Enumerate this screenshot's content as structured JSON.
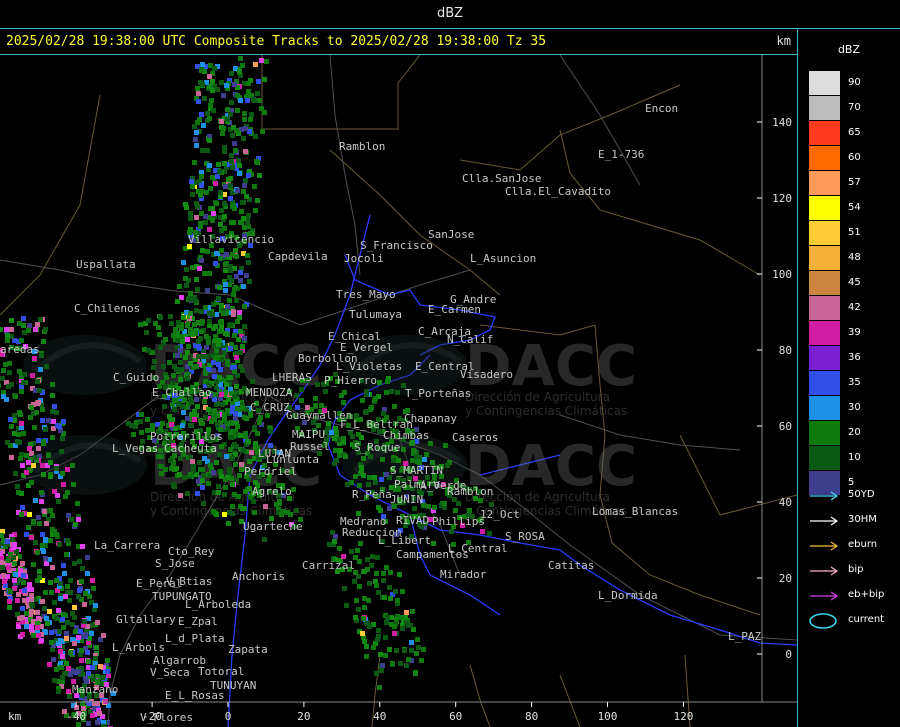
{
  "window": {
    "title": "dBZ"
  },
  "header": {
    "info": "2025/02/28 19:38:00 UTC Composite Tracks to 2025/02/28 19:38:00 Tz 35",
    "km_label": "km"
  },
  "axes": {
    "x_ticks": [
      "-40",
      "-20",
      "0",
      "20",
      "40",
      "60",
      "80",
      "100",
      "120"
    ],
    "y_ticks": [
      "140",
      "120",
      "100",
      "80",
      "60",
      "40",
      "20",
      "0"
    ],
    "x_unit": "km"
  },
  "watermark": {
    "brand": "DACC",
    "subtitle_1": "Dirección de Agricultura",
    "subtitle_2": "y Contingencias Climáticas"
  },
  "places": [
    "Uspallata",
    "C_Chilenos",
    "Villavicencio",
    "Capdevila",
    "Ramblon",
    "Encon",
    "E_1-736",
    "Clla.SanJose",
    "Clla.El_Cavadito",
    "SanJose",
    "S_Francisco",
    "Jocoli",
    "L_Asuncion",
    "Tres_Mayo",
    "Tulumaya",
    "G_Andre",
    "E_Carmen",
    "E_Chical",
    "E_Vergel",
    "C_Arcaja",
    "N_Calif",
    "Borbollon",
    "P_Hierro",
    "L_Violetas",
    "E_Central",
    "Visadero",
    "C_Guido",
    "E_Challao",
    "LHERAS",
    "MENDOZA",
    "C_CRUZ",
    "Guaymallen",
    "T_Porteñas",
    "Chapanay",
    "F_L_Beltran",
    "Potrerillos",
    "Cacheuta",
    "L_Vegas",
    "MAIPU",
    "Russel",
    "Chimbas",
    "Caseros",
    "S_Roque",
    "LUJAN",
    "Lunlunta",
    "Perdriel",
    "S_MARTIN",
    "Palmira",
    "Agrelo",
    "A_Verde",
    "Ramblon",
    "R_Peña",
    "JUNIN",
    "12_Oct",
    "Lomas_Blancas",
    "Phillips",
    "RIVAD",
    "Medrano",
    "Reduccion",
    "L_Libert",
    "S_ROSA",
    "Ugarteche",
    "La_Carrera",
    "Cto_Rey",
    "S_Jose",
    "Campamentos",
    "L_Central",
    "Catitas",
    "Carrizal",
    "Mirador",
    "E_Peral",
    "V_Btias",
    "Anchoris",
    "TUPUNGATO",
    "L_Arboleda",
    "L_Dormida",
    "Gltallary",
    "E_Zpal",
    "L_d_Plata",
    "L_Arbols",
    "Zapata",
    "L_PAZ",
    "Algarrob",
    "V_Seca",
    "Totoral",
    "Manzano",
    "E_L_Rosas",
    "TUNUYAN",
    "V_Flores",
    "aredas"
  ],
  "legend": {
    "title": "dBZ",
    "scale": [
      {
        "label": "90",
        "color": "#dcdcdc"
      },
      {
        "label": "70",
        "color": "#bdbdbd"
      },
      {
        "label": "65",
        "color": "#ff3a1e"
      },
      {
        "label": "60",
        "color": "#ff6a00"
      },
      {
        "label": "57",
        "color": "#ff9a5a"
      },
      {
        "label": "54",
        "color": "#ffff00"
      },
      {
        "label": "51",
        "color": "#ffcc33"
      },
      {
        "label": "48",
        "color": "#f7b13a"
      },
      {
        "label": "45",
        "color": "#cd853f"
      },
      {
        "label": "42",
        "color": "#c86496"
      },
      {
        "label": "39",
        "color": "#d21ea5"
      },
      {
        "label": "36",
        "color": "#7b1fd2"
      },
      {
        "label": "35",
        "color": "#2f4fe6"
      },
      {
        "label": "30",
        "color": "#1e90e6"
      },
      {
        "label": "20",
        "color": "#0e7a0e"
      },
      {
        "label": "10",
        "color": "#0a5a14"
      },
      {
        "label": "5",
        "color": "#3e3e8e"
      }
    ],
    "tracks": [
      {
        "label": "50YD",
        "color": "#40d8f0"
      },
      {
        "label": "30HM",
        "color": "#ffffff"
      },
      {
        "label": "eburn",
        "color": "#f0c040"
      },
      {
        "label": "bip",
        "color": "#ffb0d0"
      },
      {
        "label": "eb+bip",
        "color": "#e040f0"
      }
    ],
    "current": {
      "label": "current",
      "color": "#3ad4f0"
    }
  }
}
